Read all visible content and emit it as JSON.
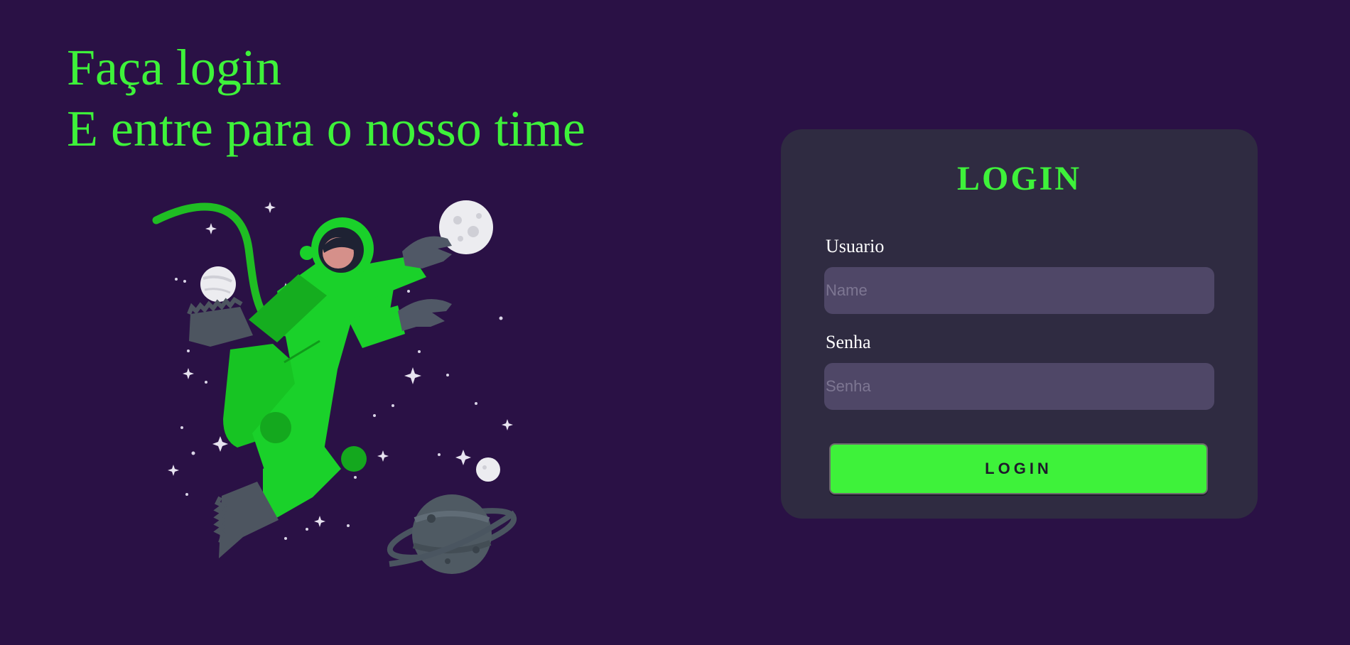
{
  "hero": {
    "line1": "Faça login",
    "line2": "E entre para o nosso time"
  },
  "login_card": {
    "title": "LOGIN",
    "username": {
      "label": "Usuario",
      "placeholder": "Name",
      "value": ""
    },
    "password": {
      "label": "Senha",
      "placeholder": "Senha",
      "value": ""
    },
    "submit_label": "LOGIN"
  },
  "colors": {
    "background": "#2a1145",
    "accent": "#3ef23a",
    "card": "#2f2b41",
    "input": "#4f4767"
  },
  "illustration": {
    "icon": "astronaut-in-space-illustration"
  }
}
